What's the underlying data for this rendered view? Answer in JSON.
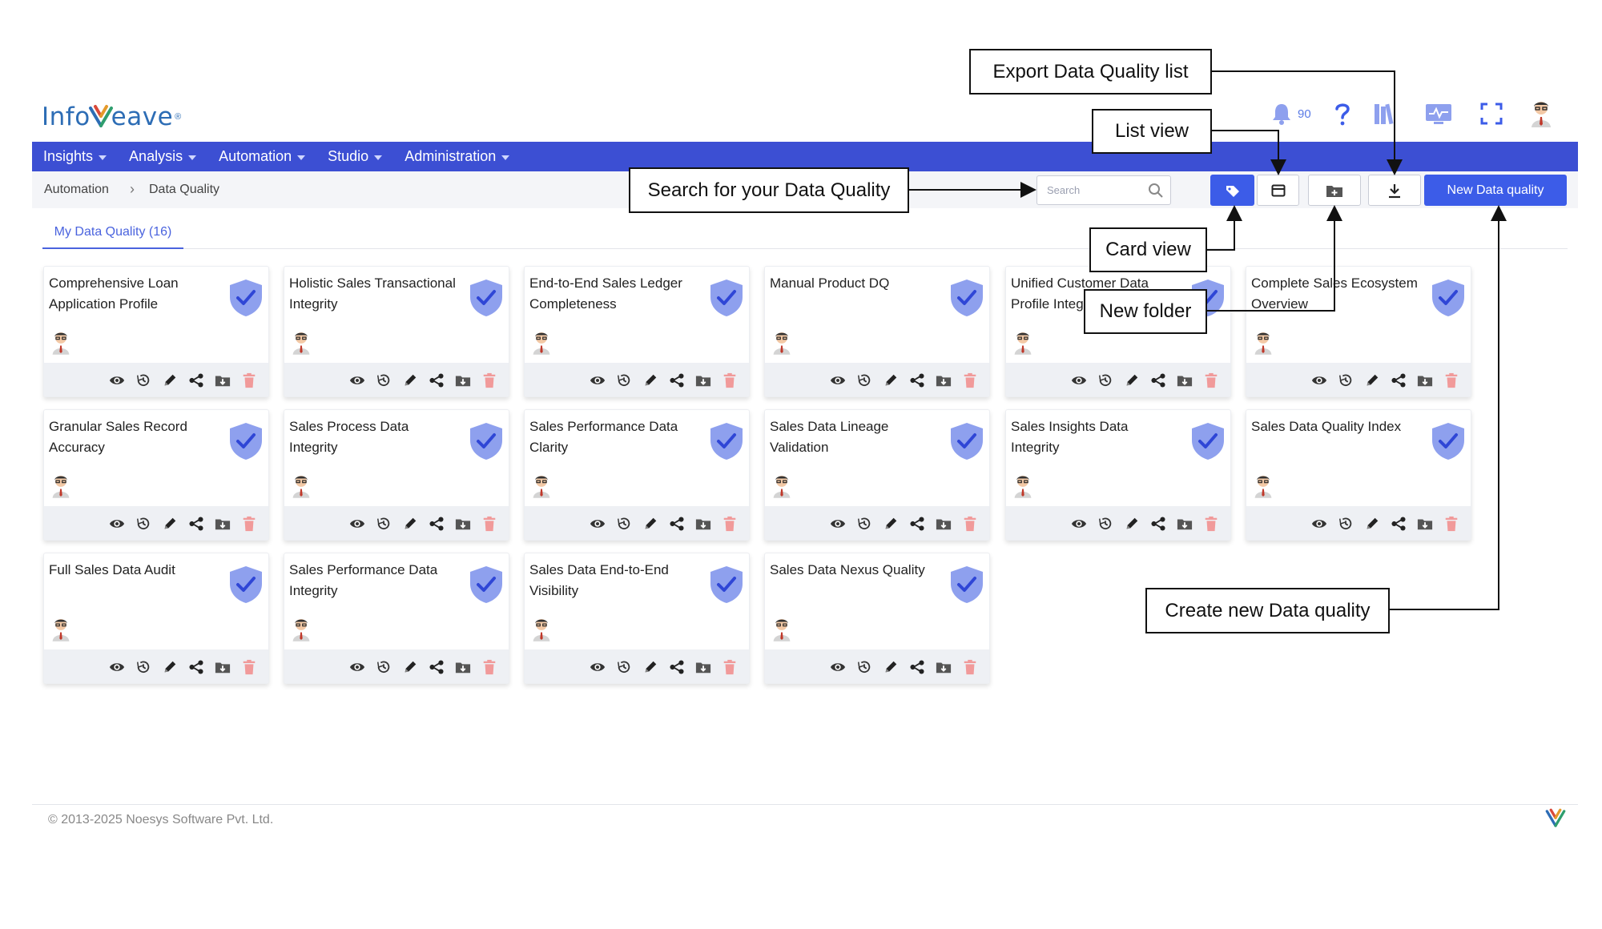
{
  "logo": {
    "text_before": "Info",
    "text_after": "eave",
    "reg": "®"
  },
  "header": {
    "notification_count": "90"
  },
  "nav": [
    "Insights",
    "Analysis",
    "Automation",
    "Studio",
    "Administration"
  ],
  "breadcrumb": {
    "parent": "Automation",
    "separator": "›",
    "current": "Data Quality"
  },
  "search": {
    "placeholder": "Search"
  },
  "new_button": "New Data quality",
  "tab": "My Data Quality (16)",
  "cards": [
    "Comprehensive Loan Application Profile",
    "Holistic Sales Transactional Integrity",
    "End-to-End Sales Ledger Completeness",
    "Manual Product DQ",
    "Unified Customer Data Profile Integrity",
    "Complete Sales Ecosystem Overview",
    "Granular Sales Record Accuracy",
    "Sales Process Data Integrity",
    "Sales Performance Data Clarity",
    "Sales Data Lineage Validation",
    "Sales Insights Data Integrity",
    "Sales Data Quality Index",
    "Full Sales Data Audit",
    "Sales Performance Data Integrity",
    "Sales Data End-to-End Visibility",
    "Sales Data Nexus Quality"
  ],
  "card_actions": [
    "view",
    "history",
    "edit",
    "share",
    "move-to-folder",
    "delete"
  ],
  "annotations": {
    "export": "Export Data Quality list",
    "list_view": "List view",
    "search": "Search for your Data Quality",
    "card_view": "Card view",
    "new_folder": "New folder",
    "create_new": "Create new Data quality"
  },
  "footer": {
    "copyright": "© 2013-2025 Noesys Software Pvt. Ltd."
  },
  "colors": {
    "nav": "#3c4fd3",
    "primary": "#3c5ce8",
    "shield": "#8ea0ee",
    "delete": "#f19a9a"
  }
}
